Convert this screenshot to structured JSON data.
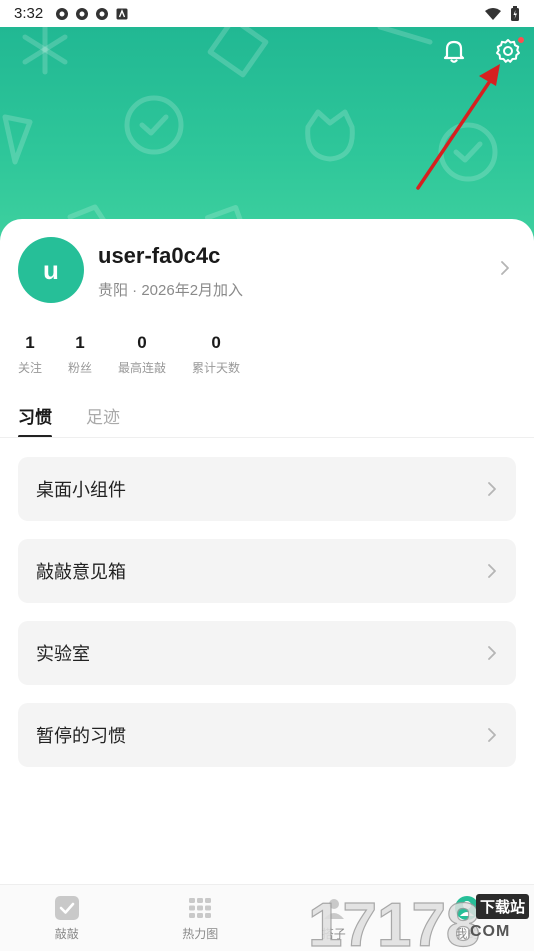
{
  "status_bar": {
    "time": "3:32"
  },
  "profile": {
    "avatar_letter": "u",
    "username": "user-fa0c4c",
    "meta": "贵阳 · 2026年2月加入"
  },
  "stats": [
    {
      "value": "1",
      "label": "关注"
    },
    {
      "value": "1",
      "label": "粉丝"
    },
    {
      "value": "0",
      "label": "最高连敲"
    },
    {
      "value": "0",
      "label": "累计天数"
    }
  ],
  "tabs": [
    {
      "label": "习惯",
      "active": true
    },
    {
      "label": "足迹",
      "active": false
    }
  ],
  "menu_items": [
    {
      "label": "桌面小组件"
    },
    {
      "label": "敲敲意见箱"
    },
    {
      "label": "实验室"
    },
    {
      "label": "暂停的习惯"
    }
  ],
  "bottom_nav": [
    {
      "label": "敲敲",
      "icon": "check-square-icon"
    },
    {
      "label": "热力图",
      "icon": "grid-icon"
    },
    {
      "label": "搭子",
      "icon": "partner-icon"
    },
    {
      "label": "我的",
      "icon": "profile-icon"
    }
  ],
  "watermark": {
    "text": "17178",
    "badge": "下载站",
    "domain": "COM"
  },
  "colors": {
    "accent": "#26bf98",
    "hero_top": "#21b893",
    "card_bg": "#f4f4f4",
    "arrow": "#d62020"
  }
}
